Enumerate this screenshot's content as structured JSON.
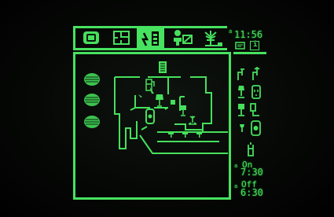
{
  "app": {
    "accent_color": "#46e05c",
    "background_color": "#000000"
  },
  "toolbar": {
    "tabs": [
      {
        "icon": "tv-icon",
        "active": false
      },
      {
        "icon": "floorplan-icon",
        "active": false
      },
      {
        "icon": "appliance-control-icon",
        "active": true
      },
      {
        "icon": "person-desk-icon",
        "active": false
      },
      {
        "icon": "lawn-sprinkler-icon",
        "active": false
      }
    ]
  },
  "status": {
    "clock_marker": "a",
    "clock": "11:56",
    "info_label": "i"
  },
  "side_panel": {
    "device_icons": [
      "faucet-cold-icon",
      "faucet-hot-icon",
      "lamp-icon",
      "outlet-icon",
      "table-lamp-icon",
      "plug-icon",
      "switch-icon",
      "appliance-icon",
      "water-heater-icon"
    ],
    "on_marker": "a",
    "on_label": "On",
    "on_time": "7:30",
    "off_marker": "a",
    "off_label": "Off",
    "off_time": "6:30"
  }
}
